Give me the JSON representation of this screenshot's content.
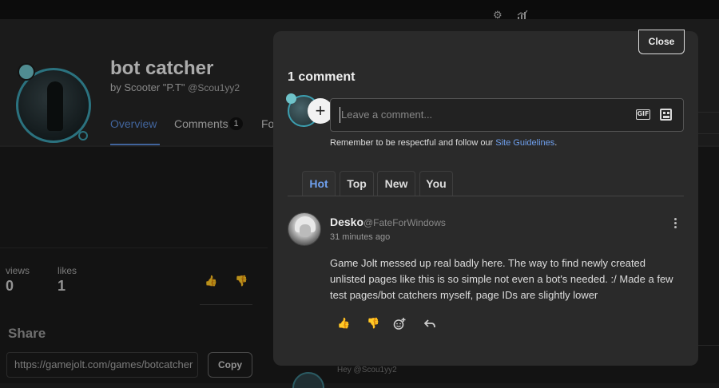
{
  "page": {
    "title": "bot catcher",
    "byline_prefix": "by Scooter \"P.T\"",
    "byline_handle": "@Scou1yy2",
    "tabs": [
      {
        "label": "Overview",
        "active": true
      },
      {
        "label": "Comments",
        "count": "1"
      },
      {
        "label": "Fo"
      }
    ],
    "stats": [
      {
        "label": "views",
        "value": "0"
      },
      {
        "label": "likes",
        "value": "1"
      }
    ],
    "share": {
      "title": "Share",
      "url": "https://gamejolt.com/games/botcatcher",
      "copy_label": "Copy"
    },
    "bg_reply_text": "Hey @Scou1yy2"
  },
  "modal": {
    "close_label": "Close",
    "count_label": "1 comment",
    "input_placeholder": "Leave a comment...",
    "gif_label": "GIF",
    "guidelines_prefix": "Remember to be respectful and follow our ",
    "guidelines_link": "Site Guidelines",
    "guidelines_suffix": ".",
    "sort_tabs": [
      {
        "label": "Hot",
        "active": true
      },
      {
        "label": "Top"
      },
      {
        "label": "New"
      },
      {
        "label": "You"
      }
    ],
    "comment": {
      "author": "Desko",
      "handle": "@FateForWindows",
      "time": "31 minutes ago",
      "body": "Game Jolt messed up real badly here. The way to find newly created unlisted pages like this is so simple not even a bot's needed. :/ Made a few test pages/bot catchers myself, page IDs are slightly lower"
    }
  },
  "colors": {
    "accent": "#6fa0ee",
    "avatar_ring": "#3c9fb0"
  }
}
